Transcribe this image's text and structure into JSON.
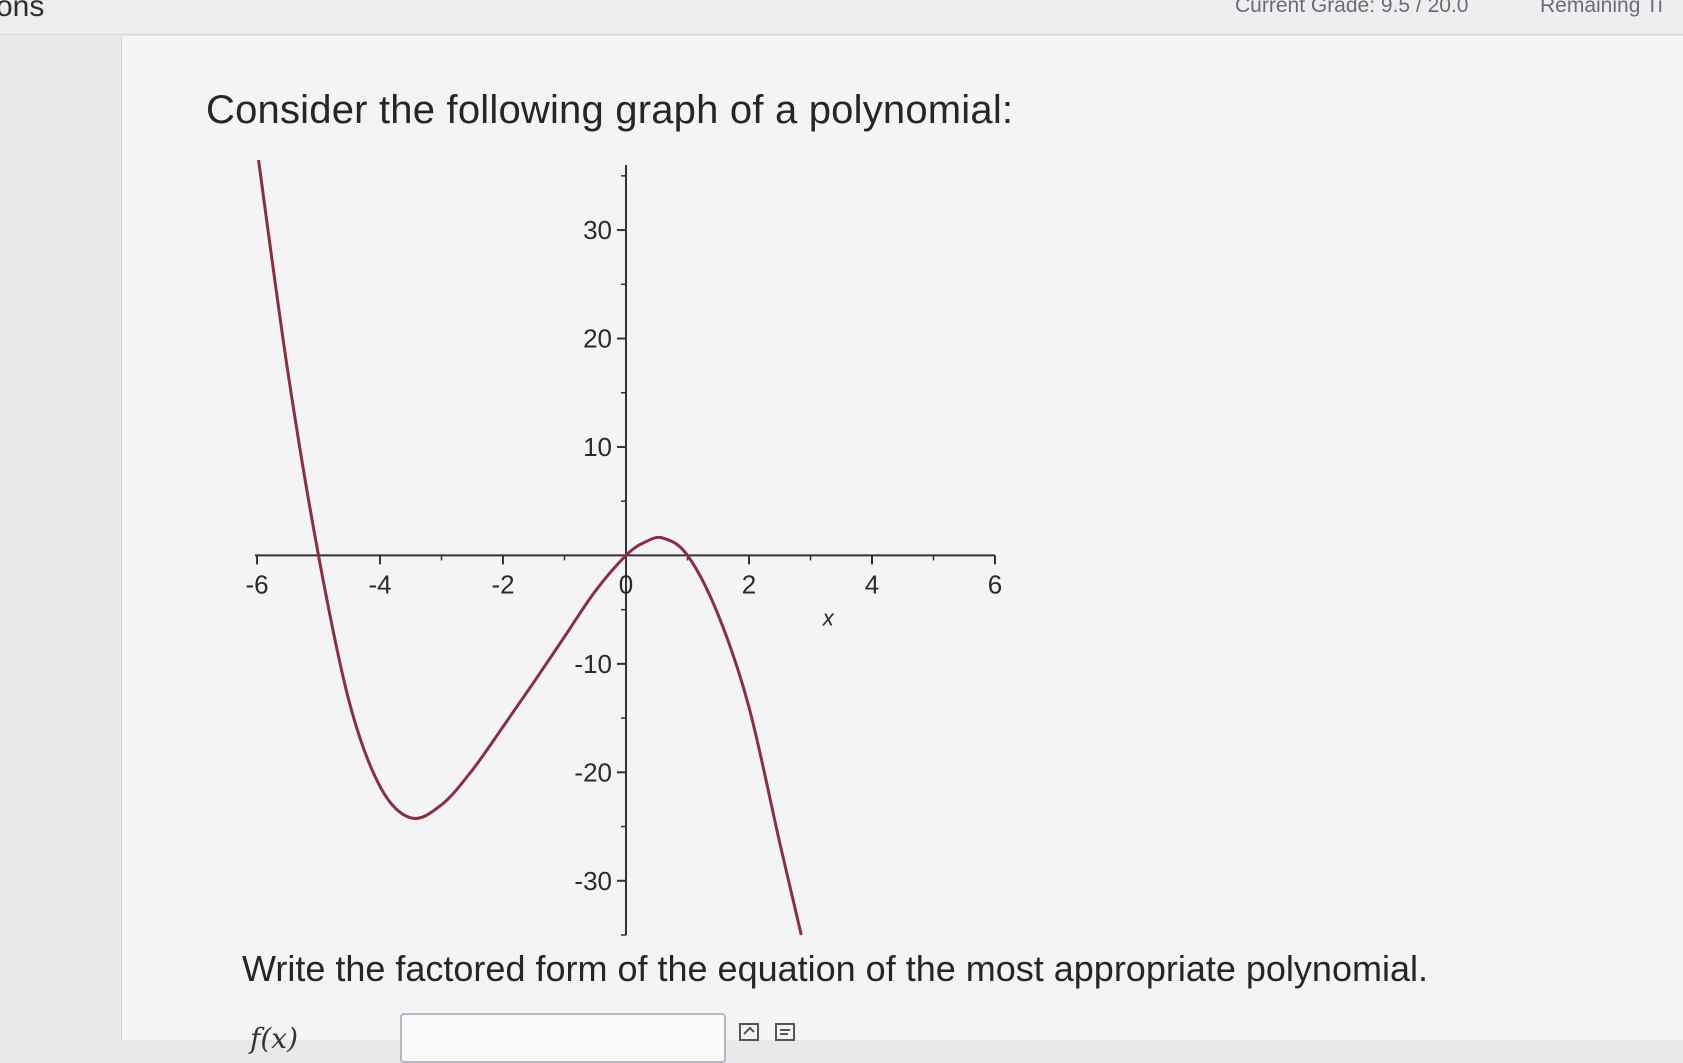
{
  "header": {
    "left_text": "ons",
    "grade": "Current Grade: 9.5 / 20.0",
    "remaining": "Remaining Ti"
  },
  "question": {
    "prompt": "Consider the following graph of a polynomial:",
    "instruction": "Write the factored form of the equation of the most appropriate polynomial.",
    "answer_label": "f(x)",
    "answer_value": ""
  },
  "chart_data": {
    "type": "line",
    "xlabel": "x",
    "ylabel": "",
    "xlim": [
      -6,
      6
    ],
    "ylim": [
      -35,
      36
    ],
    "x_ticks": [
      -6,
      -4,
      -2,
      0,
      2,
      4,
      6
    ],
    "y_ticks": [
      -30,
      -20,
      -10,
      10,
      20,
      30
    ],
    "x_tick_labels": [
      "-6",
      "-4",
      "-2",
      "0",
      "2",
      "4",
      "6"
    ],
    "y_tick_labels": [
      "-30",
      "-20",
      "-10",
      "10",
      "20",
      "30"
    ],
    "grid": false,
    "series": [
      {
        "color": "#8a2f3f",
        "x": [
          -6.0,
          -5.5,
          -5.0,
          -4.5,
          -4.0,
          -3.5,
          -3.0,
          -2.5,
          -2.0,
          -1.5,
          -1.0,
          -0.5,
          0.0,
          0.3,
          0.6,
          1.0,
          1.5,
          2.0,
          2.5,
          2.85
        ],
        "y": [
          37.5,
          17.0,
          0.0,
          -13.5,
          -21.3,
          -24.2,
          -23.0,
          -19.8,
          -15.8,
          -11.7,
          -7.5,
          -3.3,
          0.0,
          1.2,
          1.6,
          0.0,
          -5.5,
          -14.0,
          -26.5,
          -35.0
        ]
      }
    ]
  }
}
